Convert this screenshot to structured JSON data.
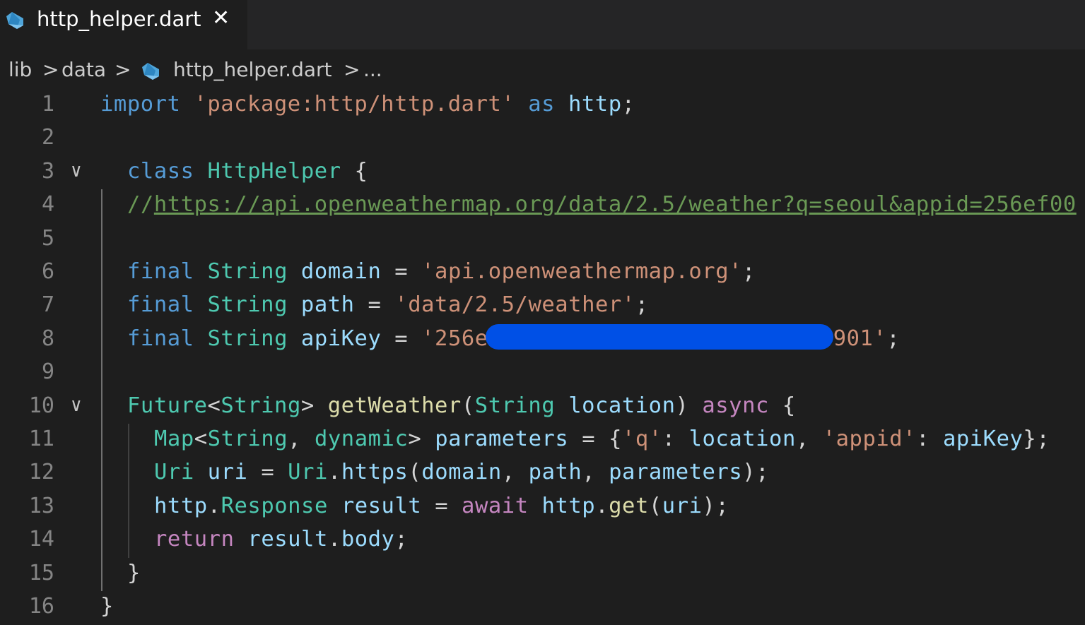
{
  "tab": {
    "title": "http_helper.dart",
    "close": "✕"
  },
  "breadcrumb": {
    "items": [
      "lib",
      "data",
      "http_helper.dart",
      "..."
    ],
    "separator": ">"
  },
  "colors": {
    "background": "#1e1e1e",
    "keyword": "#569cd6",
    "control": "#c586c0",
    "string": "#ce9178",
    "type": "#4ec9b0",
    "variable": "#9cdcfe",
    "function": "#dcdcaa",
    "comment": "#6a9955",
    "redaction": "#0050e6"
  },
  "code": {
    "lines": [
      {
        "n": "1",
        "t": [
          [
            "kw",
            "import"
          ],
          [
            "pun",
            " "
          ],
          [
            "str",
            "'package:http/http.dart'"
          ],
          [
            "pun",
            " "
          ],
          [
            "kw",
            "as"
          ],
          [
            "pun",
            " "
          ],
          [
            "var",
            "http"
          ],
          [
            "pun",
            ";"
          ]
        ]
      },
      {
        "n": "2",
        "t": []
      },
      {
        "n": "3",
        "fold": "∨",
        "t": [
          [
            "kw",
            "class"
          ],
          [
            "pun",
            " "
          ],
          [
            "typ",
            "HttpHelper"
          ],
          [
            "pun",
            " {"
          ]
        ]
      },
      {
        "n": "4",
        "t": [
          [
            "cmt",
            "//"
          ],
          [
            "url",
            "https://api.openweathermap.org/data/2.5/weather?q=seoul&appid=256ef00"
          ]
        ]
      },
      {
        "n": "5",
        "t": []
      },
      {
        "n": "6",
        "t": [
          [
            "kw",
            "final"
          ],
          [
            "pun",
            " "
          ],
          [
            "typ",
            "String"
          ],
          [
            "pun",
            " "
          ],
          [
            "var",
            "domain"
          ],
          [
            "pun",
            " = "
          ],
          [
            "str",
            "'api.openweathermap.org'"
          ],
          [
            "pun",
            ";"
          ]
        ]
      },
      {
        "n": "7",
        "t": [
          [
            "kw",
            "final"
          ],
          [
            "pun",
            " "
          ],
          [
            "typ",
            "String"
          ],
          [
            "pun",
            " "
          ],
          [
            "var",
            "path"
          ],
          [
            "pun",
            " = "
          ],
          [
            "str",
            "'data/2.5/weather'"
          ],
          [
            "pun",
            ";"
          ]
        ]
      },
      {
        "n": "8",
        "t": [
          [
            "kw",
            "final"
          ],
          [
            "pun",
            " "
          ],
          [
            "typ",
            "String"
          ],
          [
            "pun",
            " "
          ],
          [
            "var",
            "apiKey"
          ],
          [
            "pun",
            " = "
          ],
          [
            "str",
            "'256e"
          ],
          [
            "redact",
            ""
          ],
          [
            "str",
            "901'"
          ],
          [
            "pun",
            ";"
          ]
        ]
      },
      {
        "n": "9",
        "t": []
      },
      {
        "n": "10",
        "fold": "∨",
        "t": [
          [
            "typ",
            "Future"
          ],
          [
            "pun",
            "<"
          ],
          [
            "typ",
            "String"
          ],
          [
            "pun",
            "> "
          ],
          [
            "fn",
            "getWeather"
          ],
          [
            "pun",
            "("
          ],
          [
            "typ",
            "String"
          ],
          [
            "pun",
            " "
          ],
          [
            "var",
            "location"
          ],
          [
            "pun",
            ") "
          ],
          [
            "kw2",
            "async"
          ],
          [
            "pun",
            " {"
          ]
        ]
      },
      {
        "n": "11",
        "t": [
          [
            "typ",
            "Map"
          ],
          [
            "pun",
            "<"
          ],
          [
            "typ",
            "String"
          ],
          [
            "pun",
            ", "
          ],
          [
            "typ",
            "dynamic"
          ],
          [
            "pun",
            "> "
          ],
          [
            "var",
            "parameters"
          ],
          [
            "pun",
            " = {"
          ],
          [
            "str",
            "'q'"
          ],
          [
            "pun",
            ": "
          ],
          [
            "var",
            "location"
          ],
          [
            "pun",
            ", "
          ],
          [
            "str",
            "'appid'"
          ],
          [
            "pun",
            ": "
          ],
          [
            "var",
            "apiKey"
          ],
          [
            "pun",
            "};"
          ]
        ]
      },
      {
        "n": "12",
        "t": [
          [
            "typ",
            "Uri"
          ],
          [
            "pun",
            " "
          ],
          [
            "var",
            "uri"
          ],
          [
            "pun",
            " = "
          ],
          [
            "typ",
            "Uri"
          ],
          [
            "pun",
            "."
          ],
          [
            "var",
            "https"
          ],
          [
            "pun",
            "("
          ],
          [
            "var",
            "domain"
          ],
          [
            "pun",
            ", "
          ],
          [
            "var",
            "path"
          ],
          [
            "pun",
            ", "
          ],
          [
            "var",
            "parameters"
          ],
          [
            "pun",
            ");"
          ]
        ]
      },
      {
        "n": "13",
        "t": [
          [
            "var",
            "http"
          ],
          [
            "pun",
            "."
          ],
          [
            "typ",
            "Response"
          ],
          [
            "pun",
            " "
          ],
          [
            "var",
            "result"
          ],
          [
            "pun",
            " = "
          ],
          [
            "kw2",
            "await"
          ],
          [
            "pun",
            " "
          ],
          [
            "var",
            "http"
          ],
          [
            "pun",
            "."
          ],
          [
            "fn",
            "get"
          ],
          [
            "pun",
            "("
          ],
          [
            "var",
            "uri"
          ],
          [
            "pun",
            ");"
          ]
        ]
      },
      {
        "n": "14",
        "t": [
          [
            "kw2",
            "return"
          ],
          [
            "pun",
            " "
          ],
          [
            "var",
            "result"
          ],
          [
            "pun",
            "."
          ],
          [
            "var",
            "body"
          ],
          [
            "pun",
            ";"
          ]
        ]
      },
      {
        "n": "15",
        "t": [
          [
            "pun",
            "}"
          ]
        ]
      },
      {
        "n": "16",
        "t": [
          [
            "pun",
            "}"
          ]
        ]
      }
    ]
  }
}
